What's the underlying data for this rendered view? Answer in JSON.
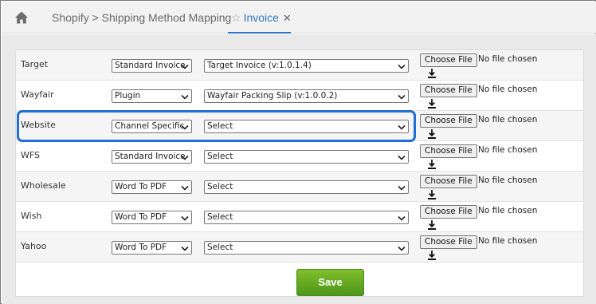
{
  "nav": {
    "mapping_tab": "Shopify > Shipping Method Mapping",
    "invoice_tab": "Invoice",
    "close_glyph": "✕",
    "star_glyph": "☆"
  },
  "file_input": {
    "button_label": "Choose File",
    "status": "No file chosen"
  },
  "rows": [
    {
      "channel": "Target",
      "type": "Standard Invoice",
      "template": "Target Invoice (v:1.0.1.4)"
    },
    {
      "channel": "Wayfair",
      "type": "Plugin",
      "template": "Wayfair Packing Slip (v:1.0.0.2)"
    },
    {
      "channel": "Website",
      "type": "Channel Specific",
      "template": "Select"
    },
    {
      "channel": "WFS",
      "type": "Standard Invoice",
      "template": "Select"
    },
    {
      "channel": "Wholesale",
      "type": "Word To PDF",
      "template": "Select"
    },
    {
      "channel": "Wish",
      "type": "Word To PDF",
      "template": "Select"
    },
    {
      "channel": "Yahoo",
      "type": "Word To PDF",
      "template": "Select"
    }
  ],
  "actions": {
    "save_label": "Save"
  },
  "colors": {
    "accent": "#2f74c0",
    "highlight": "#1f6fd6",
    "save": "#5ea322"
  },
  "icons": {
    "home": "home-icon",
    "star": "star-icon",
    "close": "close-icon",
    "dropdown": "chevron-down-icon",
    "download": "download-icon"
  }
}
